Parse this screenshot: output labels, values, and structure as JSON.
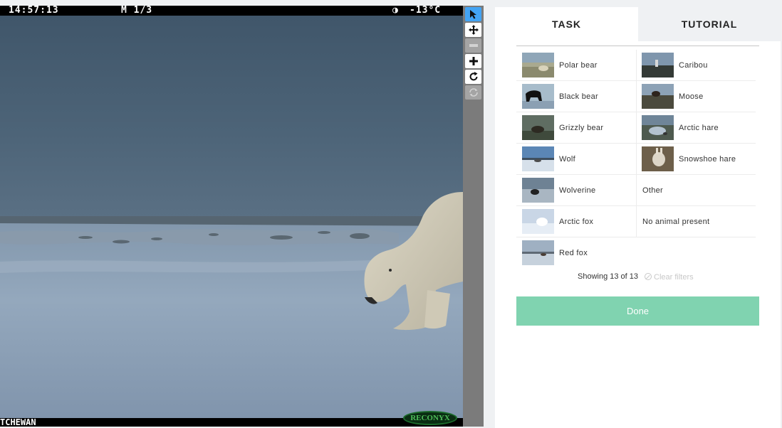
{
  "camera": {
    "time": "14:57:13",
    "mode": "M 1/3",
    "temperature": "-13°C",
    "moon_phase_icon": "moon-half-icon",
    "location_text": "TCHEWAN",
    "brand": "RECONYX",
    "sky_color": "#4e6476",
    "snow_color": "#8fa3b8"
  },
  "toolbar": {
    "tools": [
      {
        "name": "pointer",
        "icon": "cursor-arrow-icon",
        "glyph": "➤",
        "state": "active"
      },
      {
        "name": "move",
        "icon": "move-icon",
        "glyph": "✥",
        "state": "normal"
      },
      {
        "name": "zoom-out",
        "icon": "minus-icon",
        "glyph": "−",
        "state": "disabled"
      },
      {
        "name": "zoom-in",
        "icon": "plus-icon",
        "glyph": "+",
        "state": "normal"
      },
      {
        "name": "rotate",
        "icon": "rotate-icon",
        "glyph": "↻",
        "state": "normal"
      },
      {
        "name": "reset",
        "icon": "reset-icon",
        "glyph": "⟲",
        "state": "disabled"
      }
    ],
    "active_color": "#43a4f4"
  },
  "tabs": {
    "task": "TASK",
    "tutorial": "TUTORIAL"
  },
  "choices": {
    "left": [
      {
        "label": "Polar bear",
        "thumb": "polar-bear"
      },
      {
        "label": "Black bear",
        "thumb": "black-bear"
      },
      {
        "label": "Grizzly bear",
        "thumb": "grizzly-bear"
      },
      {
        "label": "Wolf",
        "thumb": "wolf"
      },
      {
        "label": "Wolverine",
        "thumb": "wolverine"
      },
      {
        "label": "Arctic fox",
        "thumb": "arctic-fox"
      },
      {
        "label": "Red fox",
        "thumb": "red-fox"
      }
    ],
    "right": [
      {
        "label": "Caribou",
        "thumb": "caribou"
      },
      {
        "label": "Moose",
        "thumb": "moose"
      },
      {
        "label": "Arctic hare",
        "thumb": "arctic-hare"
      },
      {
        "label": "Snowshoe hare",
        "thumb": "snowshoe-hare"
      },
      {
        "label": "Other",
        "thumb": null
      },
      {
        "label": "No animal present",
        "thumb": null
      }
    ]
  },
  "filters": {
    "showing": "Showing 13 of 13",
    "clear": "Clear filters"
  },
  "done_label": "Done",
  "done_color": "#80d3b0"
}
